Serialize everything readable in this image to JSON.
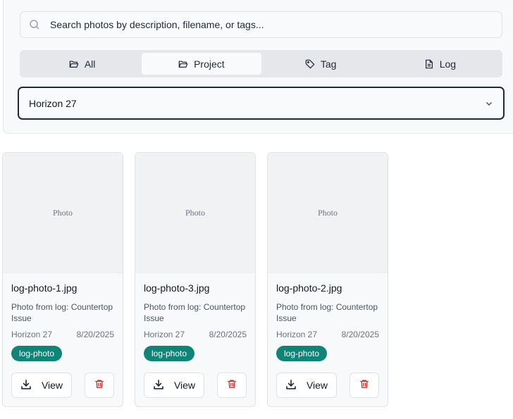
{
  "search": {
    "placeholder": "Search photos by description, filename, or tags..."
  },
  "tabs": [
    {
      "label": "All",
      "icon": "folder-open-icon",
      "active": false
    },
    {
      "label": "Project",
      "icon": "folder-open-icon",
      "active": true
    },
    {
      "label": "Tag",
      "icon": "tag-icon",
      "active": false
    },
    {
      "label": "Log",
      "icon": "document-icon",
      "active": false
    }
  ],
  "project_select": {
    "value": "Horizon 27"
  },
  "photos": [
    {
      "thumb_label": "Photo",
      "filename": "log-photo-1.jpg",
      "description": "Photo from log: Countertop Issue",
      "project": "Horizon 27",
      "date": "8/20/2025",
      "tag": "log-photo",
      "view_label": "View"
    },
    {
      "thumb_label": "Photo",
      "filename": "log-photo-3.jpg",
      "description": "Photo from log: Countertop Issue",
      "project": "Horizon 27",
      "date": "8/20/2025",
      "tag": "log-photo",
      "view_label": "View"
    },
    {
      "thumb_label": "Photo",
      "filename": "log-photo-2.jpg",
      "description": "Photo from log: Countertop Issue",
      "project": "Horizon 27",
      "date": "8/20/2025",
      "tag": "log-photo",
      "view_label": "View"
    }
  ],
  "colors": {
    "tag_bg": "#0f8577",
    "delete_icon": "#dc2626",
    "select_border": "#1f2937"
  }
}
